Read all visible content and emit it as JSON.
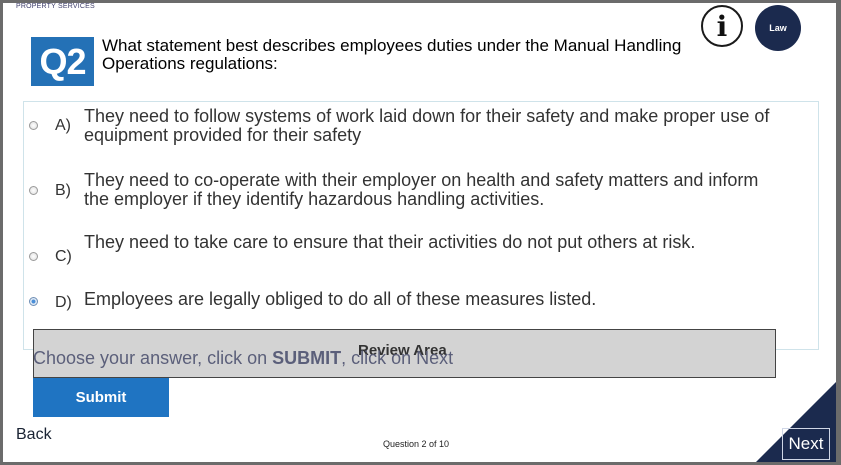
{
  "header": {
    "brand": "PROPERTY SERVICES",
    "question_badge": "Q2",
    "question_text": "What statement best describes employees duties under the Manual Handling Operations regulations:",
    "info_label": "i",
    "law_label": "Law"
  },
  "answers": [
    {
      "letter": "A)",
      "text": "They need to follow systems of work laid down for their safety and make proper use of equipment provided for their safety",
      "selected": false
    },
    {
      "letter": "B)",
      "text": "They need to co-operate with their employer on health and safety matters and inform the employer if they identify hazardous handling activities.",
      "selected": false
    },
    {
      "letter": "C)",
      "text": "They need to take care to ensure that their activities do not put others at risk.",
      "selected": false
    },
    {
      "letter": "D)",
      "text": "Employees are legally obliged to do all of these measures listed.",
      "selected": true
    }
  ],
  "review": {
    "label": "Review Area",
    "instruction_prefix": "Choose your answer, click on ",
    "instruction_bold": "SUBMIT",
    "instruction_suffix": ", click on Next"
  },
  "footer": {
    "submit_label": "Submit",
    "back_label": "Back",
    "progress": "Question 2 of 10",
    "next_label": "Next"
  },
  "colors": {
    "badge": "#2471b6",
    "submit": "#1f74c2",
    "navy": "#1b2a4e"
  }
}
